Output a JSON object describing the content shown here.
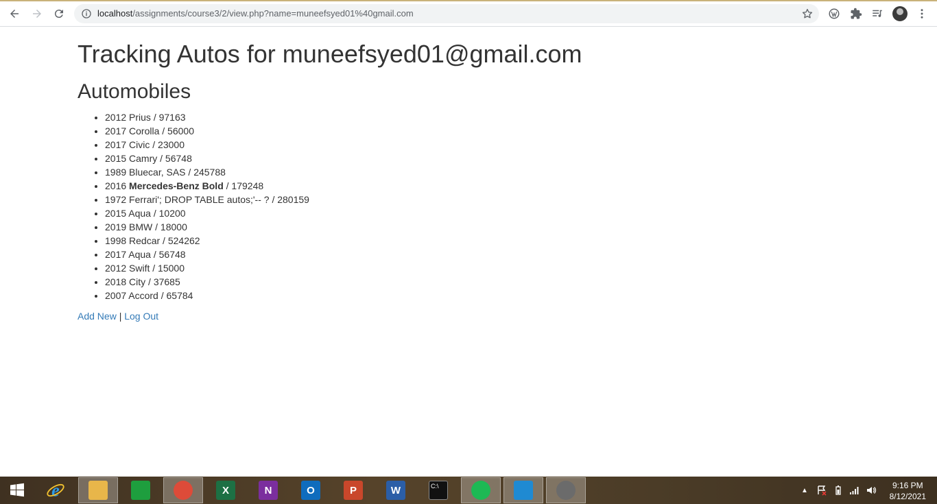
{
  "browser": {
    "url_host": "localhost",
    "url_path": "/assignments/course3/2/view.php?name=muneefsyed01%40gmail.com"
  },
  "page": {
    "title": "Tracking Autos for muneefsyed01@gmail.com",
    "section_heading": "Automobiles",
    "autos": [
      {
        "pre": "2012 Prius",
        "bold": "",
        "post": " / 97163"
      },
      {
        "pre": "2017 Corolla",
        "bold": "",
        "post": " / 56000"
      },
      {
        "pre": "2017 Civic",
        "bold": "",
        "post": " / 23000"
      },
      {
        "pre": "2015 Camry",
        "bold": "",
        "post": " / 56748"
      },
      {
        "pre": "1989 Bluecar, SAS",
        "bold": "",
        "post": " / 245788"
      },
      {
        "pre": "2016 ",
        "bold": "Mercedes-Benz Bold",
        "post": " / 179248"
      },
      {
        "pre": "1972 Ferrari'; DROP TABLE autos;'-- ?",
        "bold": "",
        "post": " / 280159"
      },
      {
        "pre": "2015 Aqua",
        "bold": "",
        "post": " / 10200"
      },
      {
        "pre": "2019 BMW",
        "bold": "",
        "post": " / 18000"
      },
      {
        "pre": "1998 Redcar",
        "bold": "",
        "post": " / 524262"
      },
      {
        "pre": "2017 Aqua",
        "bold": "",
        "post": " / 56748"
      },
      {
        "pre": "2012 Swift",
        "bold": "",
        "post": " / 15000"
      },
      {
        "pre": "2018 City",
        "bold": "",
        "post": " / 37685"
      },
      {
        "pre": "2007 Accord",
        "bold": "",
        "post": " / 65784"
      }
    ],
    "add_new_label": "Add New",
    "separator": " | ",
    "logout_label": "Log Out"
  },
  "taskbar": {
    "apps": [
      {
        "name": "file-explorer",
        "letter": "",
        "color": "#e8b64a",
        "active": true
      },
      {
        "name": "store",
        "letter": "",
        "color": "#1e9e3e",
        "active": false
      },
      {
        "name": "chrome",
        "letter": "",
        "color": "#dd4b39",
        "active": true
      },
      {
        "name": "excel",
        "letter": "X",
        "color": "#1d7044",
        "active": false
      },
      {
        "name": "onenote",
        "letter": "N",
        "color": "#7b2e9e",
        "active": false
      },
      {
        "name": "outlook",
        "letter": "O",
        "color": "#0f6cbd",
        "active": false
      },
      {
        "name": "powerpoint",
        "letter": "P",
        "color": "#c9472b",
        "active": false
      },
      {
        "name": "word",
        "letter": "W",
        "color": "#2b5ea7",
        "active": false
      },
      {
        "name": "command-prompt",
        "letter": "C:\\",
        "color": "#111111",
        "active": false
      },
      {
        "name": "spotify",
        "letter": "",
        "color": "#1db954",
        "active": true
      },
      {
        "name": "vscode",
        "letter": "",
        "color": "#1f8ad2",
        "active": true
      },
      {
        "name": "zotero-app",
        "letter": "",
        "color": "#6b6b6b",
        "active": true
      }
    ],
    "time": "9:16 PM",
    "date": "8/12/2021"
  }
}
